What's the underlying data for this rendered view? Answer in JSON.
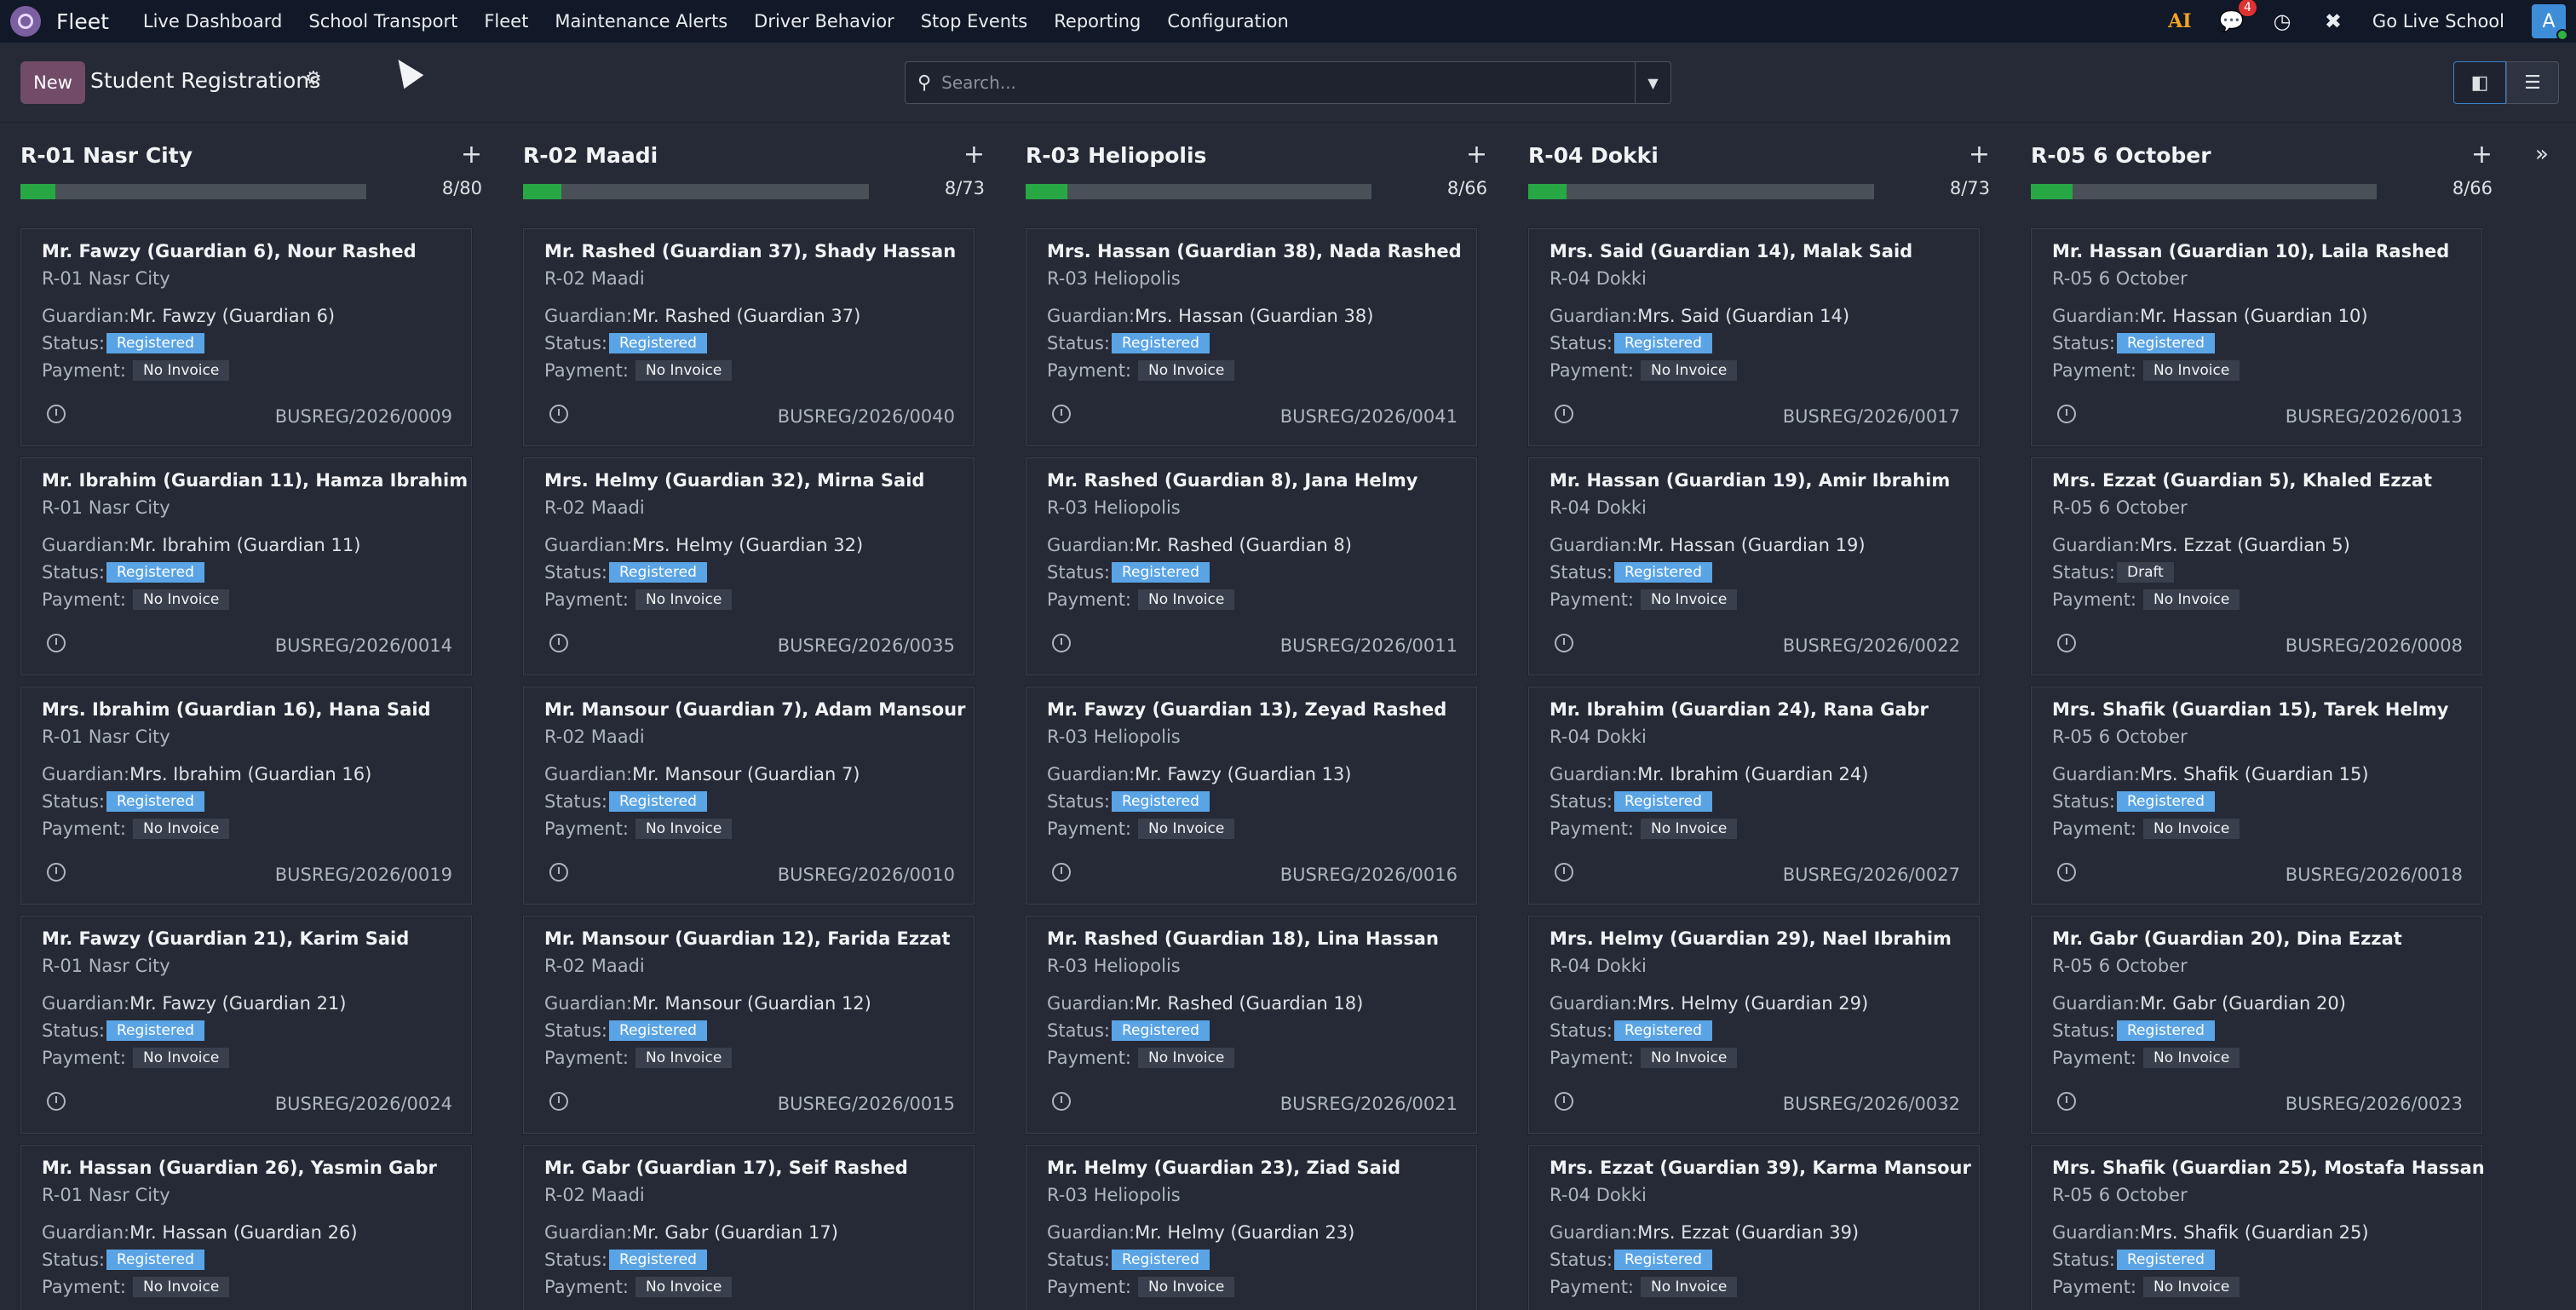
{
  "navbar": {
    "brand": "Fleet",
    "items": [
      "Live Dashboard",
      "School Transport",
      "Fleet",
      "Maintenance Alerts",
      "Driver Behavior",
      "Stop Events",
      "Reporting",
      "Configuration"
    ],
    "ai_label": "AI",
    "chat_count": "4",
    "company": "Go Live School",
    "avatar_letter": "A"
  },
  "control": {
    "new_label": "New",
    "title": "Student Registrations",
    "search_placeholder": "Search..."
  },
  "columns": [
    {
      "title": "R-01 Nasr City",
      "count": "8/80",
      "progress": 0.1,
      "cards": [
        {
          "name": "Mr. Fawzy (Guardian 6), Nour Rashed",
          "route": "R-01 Nasr City",
          "guardian": "Mr. Fawzy (Guardian 6)",
          "status": "Registered",
          "payment": "No Invoice",
          "ref": "BUSREG/2026/0009"
        },
        {
          "name": "Mr. Ibrahim (Guardian 11), Hamza Ibrahim",
          "route": "R-01 Nasr City",
          "guardian": "Mr. Ibrahim (Guardian 11)",
          "status": "Registered",
          "payment": "No Invoice",
          "ref": "BUSREG/2026/0014"
        },
        {
          "name": "Mrs. Ibrahim (Guardian 16), Hana Said",
          "route": "R-01 Nasr City",
          "guardian": "Mrs. Ibrahim (Guardian 16)",
          "status": "Registered",
          "payment": "No Invoice",
          "ref": "BUSREG/2026/0019"
        },
        {
          "name": "Mr. Fawzy (Guardian 21), Karim Said",
          "route": "R-01 Nasr City",
          "guardian": "Mr. Fawzy (Guardian 21)",
          "status": "Registered",
          "payment": "No Invoice",
          "ref": "BUSREG/2026/0024"
        },
        {
          "name": "Mr. Hassan (Guardian 26), Yasmin Gabr",
          "route": "R-01 Nasr City",
          "guardian": "Mr. Hassan (Guardian 26)",
          "status": "Registered",
          "payment": "No Invoice",
          "ref": ""
        }
      ]
    },
    {
      "title": "R-02 Maadi",
      "count": "8/73",
      "progress": 0.11,
      "cards": [
        {
          "name": "Mr. Rashed (Guardian 37), Shady Hassan",
          "route": "R-02 Maadi",
          "guardian": "Mr. Rashed (Guardian 37)",
          "status": "Registered",
          "payment": "No Invoice",
          "ref": "BUSREG/2026/0040"
        },
        {
          "name": "Mrs. Helmy (Guardian 32), Mirna Said",
          "route": "R-02 Maadi",
          "guardian": "Mrs. Helmy (Guardian 32)",
          "status": "Registered",
          "payment": "No Invoice",
          "ref": "BUSREG/2026/0035"
        },
        {
          "name": "Mr. Mansour (Guardian 7), Adam Mansour",
          "route": "R-02 Maadi",
          "guardian": "Mr. Mansour (Guardian 7)",
          "status": "Registered",
          "payment": "No Invoice",
          "ref": "BUSREG/2026/0010"
        },
        {
          "name": "Mr. Mansour (Guardian 12), Farida Ezzat",
          "route": "R-02 Maadi",
          "guardian": "Mr. Mansour (Guardian 12)",
          "status": "Registered",
          "payment": "No Invoice",
          "ref": "BUSREG/2026/0015"
        },
        {
          "name": "Mr. Gabr (Guardian 17), Seif Rashed",
          "route": "R-02 Maadi",
          "guardian": "Mr. Gabr (Guardian 17)",
          "status": "Registered",
          "payment": "No Invoice",
          "ref": ""
        }
      ]
    },
    {
      "title": "R-03 Heliopolis",
      "count": "8/66",
      "progress": 0.12,
      "cards": [
        {
          "name": "Mrs. Hassan (Guardian 38), Nada Rashed",
          "route": "R-03 Heliopolis",
          "guardian": "Mrs. Hassan (Guardian 38)",
          "status": "Registered",
          "payment": "No Invoice",
          "ref": "BUSREG/2026/0041"
        },
        {
          "name": "Mr. Rashed (Guardian 8), Jana Helmy",
          "route": "R-03 Heliopolis",
          "guardian": "Mr. Rashed (Guardian 8)",
          "status": "Registered",
          "payment": "No Invoice",
          "ref": "BUSREG/2026/0011"
        },
        {
          "name": "Mr. Fawzy (Guardian 13), Zeyad Rashed",
          "route": "R-03 Heliopolis",
          "guardian": "Mr. Fawzy (Guardian 13)",
          "status": "Registered",
          "payment": "No Invoice",
          "ref": "BUSREG/2026/0016"
        },
        {
          "name": "Mr. Rashed (Guardian 18), Lina Hassan",
          "route": "R-03 Heliopolis",
          "guardian": "Mr. Rashed (Guardian 18)",
          "status": "Registered",
          "payment": "No Invoice",
          "ref": "BUSREG/2026/0021"
        },
        {
          "name": "Mr. Helmy (Guardian 23), Ziad Said",
          "route": "R-03 Heliopolis",
          "guardian": "Mr. Helmy (Guardian 23)",
          "status": "Registered",
          "payment": "No Invoice",
          "ref": ""
        }
      ]
    },
    {
      "title": "R-04 Dokki",
      "count": "8/73",
      "progress": 0.11,
      "cards": [
        {
          "name": "Mrs. Said (Guardian 14), Malak Said",
          "route": "R-04 Dokki",
          "guardian": "Mrs. Said (Guardian 14)",
          "status": "Registered",
          "payment": "No Invoice",
          "ref": "BUSREG/2026/0017"
        },
        {
          "name": "Mr. Hassan (Guardian 19), Amir Ibrahim",
          "route": "R-04 Dokki",
          "guardian": "Mr. Hassan (Guardian 19)",
          "status": "Registered",
          "payment": "No Invoice",
          "ref": "BUSREG/2026/0022"
        },
        {
          "name": "Mr. Ibrahim (Guardian 24), Rana Gabr",
          "route": "R-04 Dokki",
          "guardian": "Mr. Ibrahim (Guardian 24)",
          "status": "Registered",
          "payment": "No Invoice",
          "ref": "BUSREG/2026/0027"
        },
        {
          "name": "Mrs. Helmy (Guardian 29), Nael Ibrahim",
          "route": "R-04 Dokki",
          "guardian": "Mrs. Helmy (Guardian 29)",
          "status": "Registered",
          "payment": "No Invoice",
          "ref": "BUSREG/2026/0032"
        },
        {
          "name": "Mrs. Ezzat (Guardian 39), Karma Mansour",
          "route": "R-04 Dokki",
          "guardian": "Mrs. Ezzat (Guardian 39)",
          "status": "Registered",
          "payment": "No Invoice",
          "ref": ""
        }
      ]
    },
    {
      "title": "R-05 6 October",
      "count": "8/66",
      "progress": 0.12,
      "cards": [
        {
          "name": "Mr. Hassan (Guardian 10), Laila Rashed",
          "route": "R-05 6 October",
          "guardian": "Mr. Hassan (Guardian 10)",
          "status": "Registered",
          "payment": "No Invoice",
          "ref": "BUSREG/2026/0013"
        },
        {
          "name": "Mrs. Ezzat (Guardian 5), Khaled Ezzat",
          "route": "R-05 6 October",
          "guardian": "Mrs. Ezzat (Guardian 5)",
          "status": "Draft",
          "payment": "No Invoice",
          "ref": "BUSREG/2026/0008"
        },
        {
          "name": "Mrs. Shafik (Guardian 15), Tarek Helmy",
          "route": "R-05 6 October",
          "guardian": "Mrs. Shafik (Guardian 15)",
          "status": "Registered",
          "payment": "No Invoice",
          "ref": "BUSREG/2026/0018"
        },
        {
          "name": "Mr. Gabr (Guardian 20), Dina Ezzat",
          "route": "R-05 6 October",
          "guardian": "Mr. Gabr (Guardian 20)",
          "status": "Registered",
          "payment": "No Invoice",
          "ref": "BUSREG/2026/0023"
        },
        {
          "name": "Mrs. Shafik (Guardian 25), Mostafa Hassan",
          "route": "R-05 6 October",
          "guardian": "Mrs. Shafik (Guardian 25)",
          "status": "Registered",
          "payment": "No Invoice",
          "ref": ""
        }
      ]
    }
  ],
  "labels": {
    "guardian": "Guardian:",
    "status": "Status:",
    "payment": "Payment:"
  },
  "colors": {
    "navbar_bg": "#111827",
    "body_bg": "#262a36",
    "brand_button": "#714b67",
    "progress_fill": "#28a745",
    "registered_badge": "#5aa4e6"
  }
}
